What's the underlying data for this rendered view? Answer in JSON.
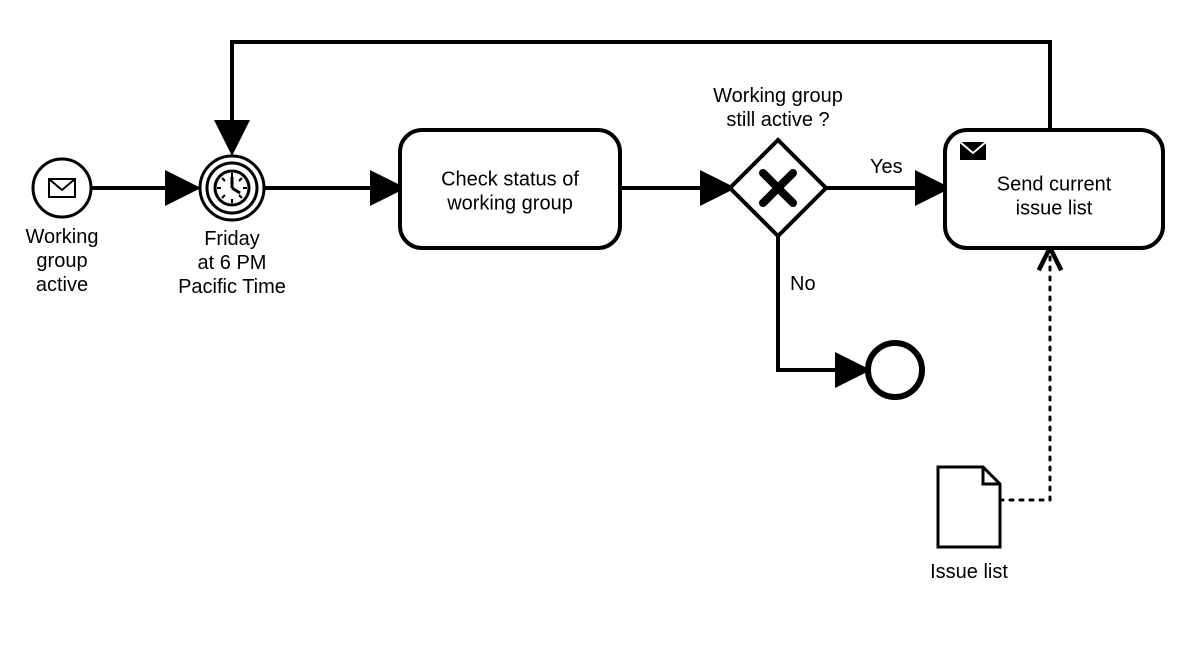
{
  "diagram": {
    "type": "BPMN",
    "nodes": {
      "start_event": {
        "kind": "message-start-event",
        "label_lines": [
          "Working",
          "group",
          "active"
        ]
      },
      "timer_event": {
        "kind": "timer-intermediate-event",
        "label_lines": [
          "Friday",
          "at 6 PM",
          "Pacific Time"
        ]
      },
      "task_check": {
        "kind": "task",
        "label_lines": [
          "Check status of",
          "working group"
        ]
      },
      "gateway": {
        "kind": "exclusive-gateway",
        "question_lines": [
          "Working group",
          "still active ?"
        ]
      },
      "task_send": {
        "kind": "send-task",
        "label_lines": [
          "Send current",
          "issue list"
        ]
      },
      "end_event": {
        "kind": "end-event"
      },
      "data_object": {
        "kind": "data-object",
        "label": "Issue list"
      }
    },
    "edges": {
      "yes": "Yes",
      "no": "No"
    }
  }
}
